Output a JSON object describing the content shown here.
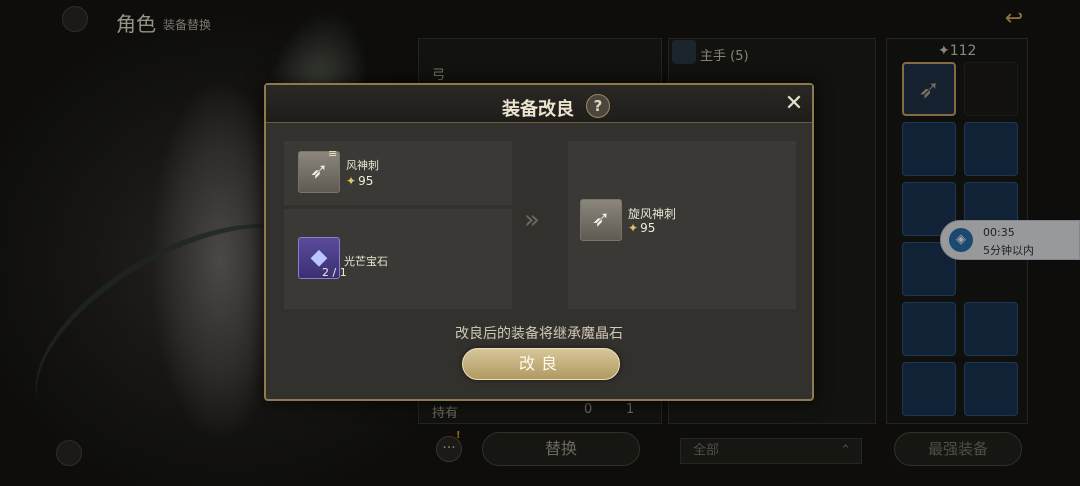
{
  "header": {
    "title": "角色",
    "subtitle": "装备替换"
  },
  "middle_panel": {
    "weapon_type": "弓",
    "own_label": "持有",
    "own_count_a": "0",
    "own_count_b": "1"
  },
  "list_panel": {
    "header": "主手 (5)"
  },
  "grid_panel": {
    "count": "112"
  },
  "timer": {
    "time": "00:35",
    "note": "5分钟以内"
  },
  "bottom_bar": {
    "swap_label": "替换",
    "filter_value": "全部",
    "best_label": "最强装备",
    "more_alert": "!"
  },
  "modal": {
    "title": "装备改良",
    "help": "?",
    "source_item": {
      "name": "风神刺",
      "level": "95"
    },
    "material": {
      "name": "光芒宝石",
      "count": "2 / 1"
    },
    "result_item": {
      "name": "旋风神刺",
      "level": "95"
    },
    "notice": "改良后的装备将继承魔晶石",
    "confirm_label": "改良"
  },
  "icons": [
    "back-icon",
    "help-icon",
    "close-icon",
    "star-icon",
    "bow-icon",
    "gem-icon",
    "more-icon",
    "person-icon",
    "chevron-down-icon",
    "timer-icon"
  ]
}
